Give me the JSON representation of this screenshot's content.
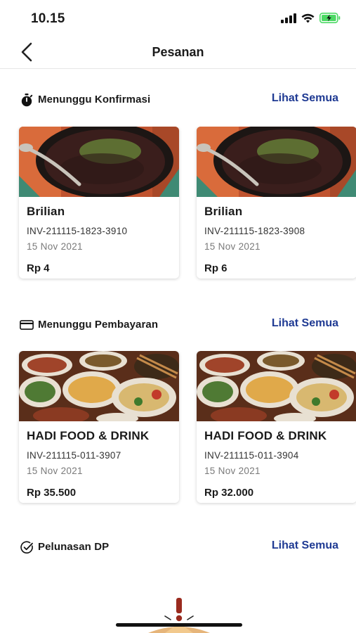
{
  "status_bar": {
    "time": "10.15",
    "battery_color": "#4cd964"
  },
  "header": {
    "title": "Pesanan",
    "back_icon": "chevron-left-icon"
  },
  "sections": [
    {
      "title": "Menunggu Konfirmasi",
      "icon": "stopwatch-icon",
      "see_all": "Lihat Semua",
      "cards": [
        {
          "name": "Brilian",
          "invoice": "INV-211115-1823-3910",
          "date": "15 Nov 2021",
          "price": "Rp 4",
          "image": "rice-dish-image"
        },
        {
          "name": "Brilian",
          "invoice": "INV-211115-1823-3908",
          "date": "15 Nov 2021",
          "price": "Rp 6",
          "image": "rice-dish-image"
        }
      ]
    },
    {
      "title": "Menunggu Pembayaran",
      "icon": "credit-card-icon",
      "see_all": "Lihat Semua",
      "cards": [
        {
          "name": "HADI FOOD & DRINK",
          "invoice": "INV-211115-011-3907",
          "date": "15 Nov 2021",
          "price": "Rp 35.500",
          "image": "food-spread-image"
        },
        {
          "name": "HADI FOOD & DRINK",
          "invoice": "INV-211115-011-3904",
          "date": "15 Nov 2021",
          "price": "Rp 32.000",
          "image": "food-spread-image"
        }
      ]
    },
    {
      "title": "Pelunasan DP",
      "icon": "check-circle-icon",
      "see_all": "Lihat Semua",
      "cards": []
    }
  ],
  "colors": {
    "link": "#1f3a93",
    "text": "#1a1a1a",
    "muted": "#7a7a7a",
    "divider": "#e6e6e6"
  }
}
